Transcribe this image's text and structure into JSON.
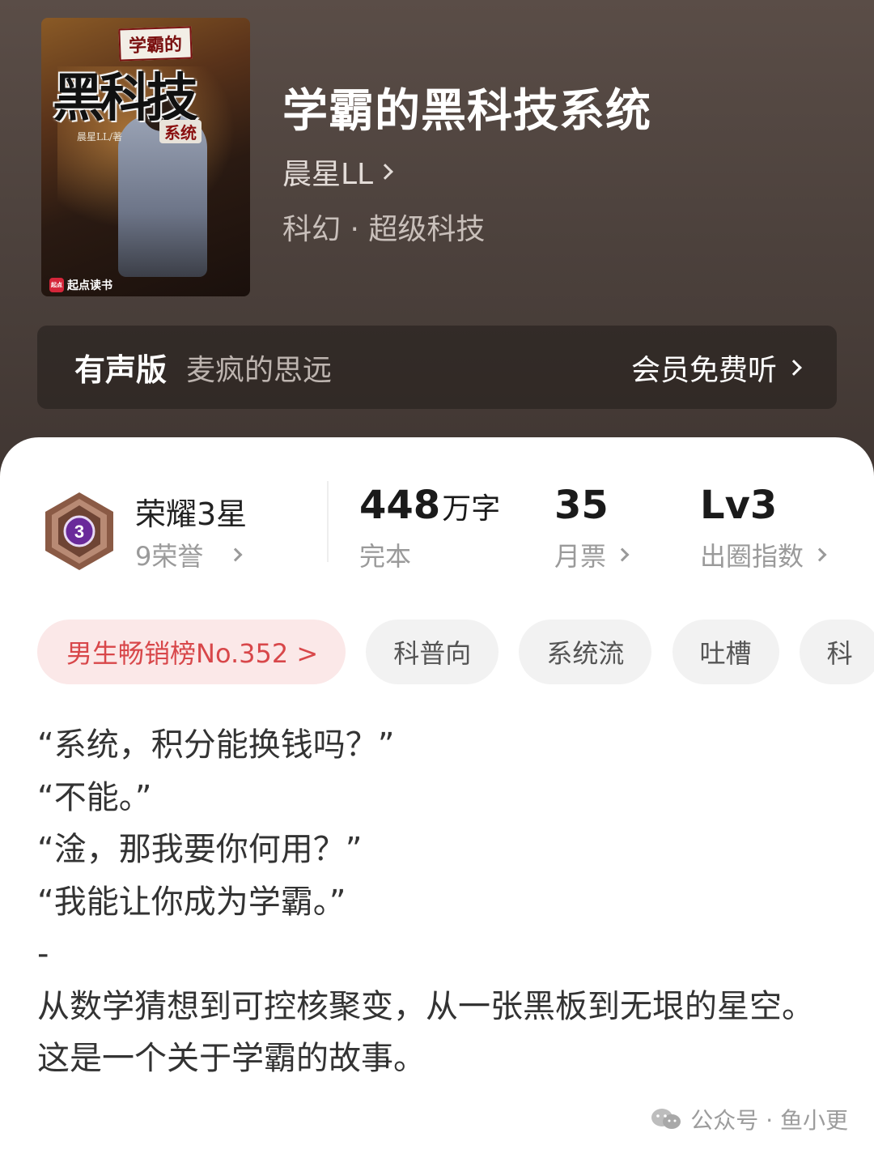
{
  "cover": {
    "ribbon_text": "学霸的",
    "big_text": "黑科技",
    "sub_text": "系统",
    "byline_text": "晨星LL/著",
    "publisher_text": "起点读书",
    "publisher_mark": "起点"
  },
  "book": {
    "title": "学霸的黑科技系统",
    "author": "晨星LL",
    "genre": "科幻 · 超级科技"
  },
  "audio": {
    "label": "有声版",
    "narrator": "麦疯的思远",
    "cta": "会员免费听"
  },
  "honor": {
    "title": "荣耀3星",
    "subtitle": "9荣誉",
    "badge_number": "3"
  },
  "stats": [
    {
      "value": "448",
      "unit": "万字",
      "label": "完本"
    },
    {
      "value": "35",
      "unit": "",
      "label": "月票"
    },
    {
      "value": "Lv3",
      "unit": "",
      "label": "出圈指数"
    }
  ],
  "tags": {
    "rank": "男生畅销榜No.352 >",
    "items": [
      "科普向",
      "系统流",
      "吐槽",
      "科"
    ]
  },
  "blurb": [
    "“系统，积分能换钱吗？”",
    "“不能。”",
    "“淦，那我要你何用？”",
    "“我能让你成为学霸。”",
    "-",
    "从数学猜想到可控核聚变，从一张黑板到无垠的星空。",
    "这是一个关于学霸的故事。"
  ],
  "watermark": "公众号 · 鱼小更",
  "colors": {
    "header_bg": "#4d423d",
    "rank_tag_bg": "#fbe8e8",
    "rank_tag_text": "#d8474a",
    "badge_purple": "#6a2a9a"
  }
}
